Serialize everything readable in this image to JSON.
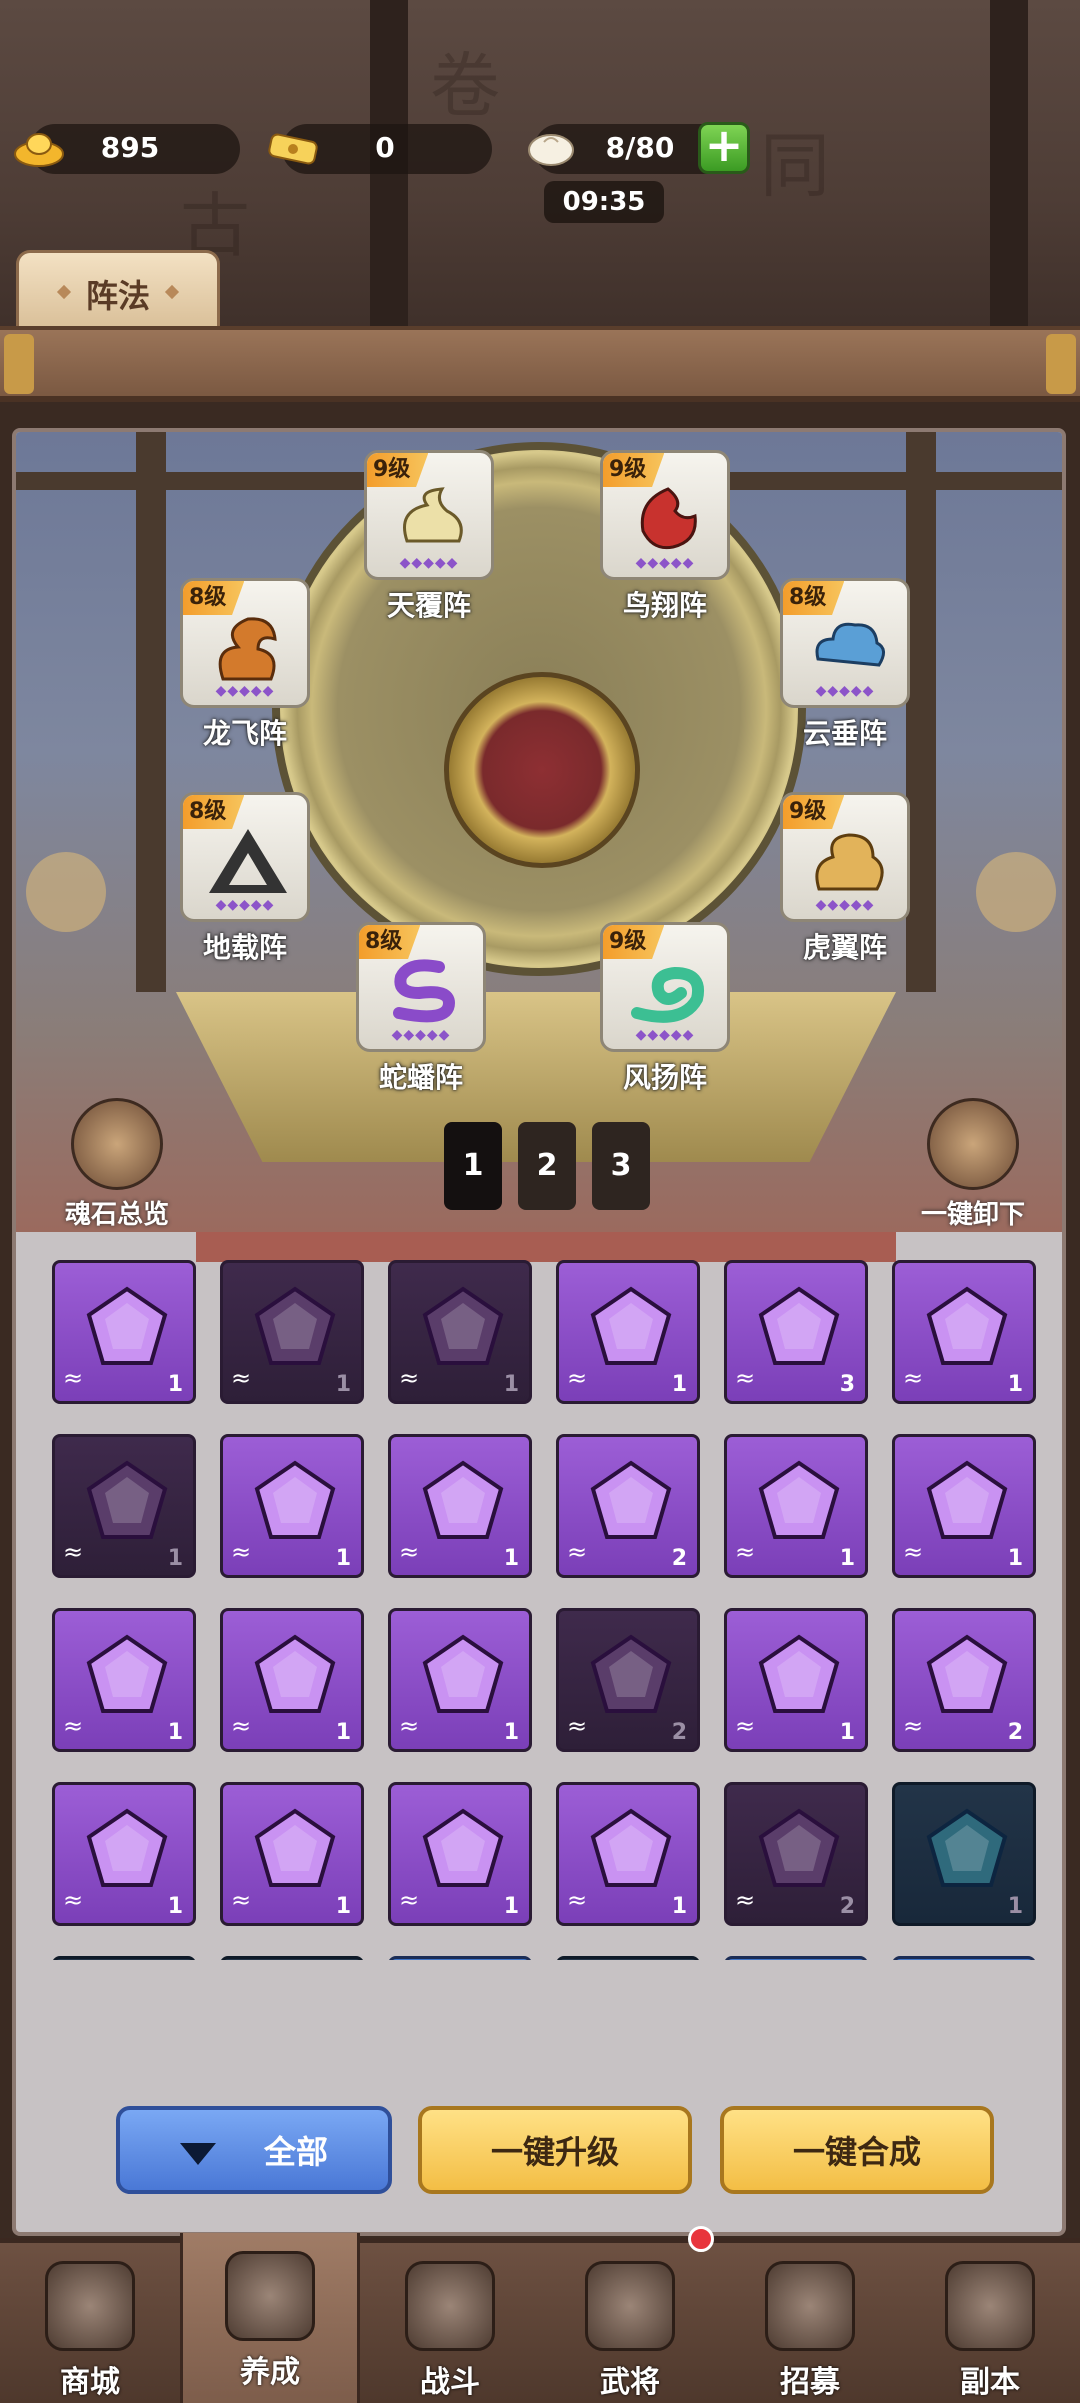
{
  "resources": {
    "gold": "895",
    "ingot": "0",
    "stamina": "8/80",
    "timer": "09:35"
  },
  "tab": {
    "label": "阵法"
  },
  "formations": [
    {
      "level": "9级",
      "name": "天覆阵",
      "color": "#e8d79a"
    },
    {
      "level": "9级",
      "name": "鸟翔阵",
      "color": "#c8322e"
    },
    {
      "level": "8级",
      "name": "龙飞阵",
      "color": "#d37a2c"
    },
    {
      "level": "8级",
      "name": "云垂阵",
      "color": "#5a9fd6"
    },
    {
      "level": "8级",
      "name": "地载阵",
      "color": "#333333"
    },
    {
      "level": "9级",
      "name": "虎翼阵",
      "color": "#e2b35a"
    },
    {
      "level": "8级",
      "name": "蛇蟠阵",
      "color": "#8a4bc9"
    },
    {
      "level": "9级",
      "name": "风扬阵",
      "color": "#3cbf93"
    }
  ],
  "side_buttons": {
    "soulstone_overview": "魂石总览",
    "unequip_all": "一键卸下"
  },
  "pages": [
    "1",
    "2",
    "3"
  ],
  "gems": [
    {
      "style": "purple",
      "count": "1"
    },
    {
      "style": "dim",
      "count": "1"
    },
    {
      "style": "dim",
      "count": "1"
    },
    {
      "style": "purple",
      "count": "1"
    },
    {
      "style": "purple",
      "count": "3"
    },
    {
      "style": "purple",
      "count": "1"
    },
    {
      "style": "dim",
      "count": "1"
    },
    {
      "style": "purple",
      "count": "1"
    },
    {
      "style": "purple",
      "count": "1"
    },
    {
      "style": "purple",
      "count": "2"
    },
    {
      "style": "purple",
      "count": "1"
    },
    {
      "style": "purple",
      "count": "1"
    },
    {
      "style": "purple",
      "count": "1"
    },
    {
      "style": "purple",
      "count": "1"
    },
    {
      "style": "purple",
      "count": "1"
    },
    {
      "style": "dim",
      "count": "2"
    },
    {
      "style": "purple",
      "count": "1"
    },
    {
      "style": "purple",
      "count": "2"
    },
    {
      "style": "purple",
      "count": "1"
    },
    {
      "style": "purple",
      "count": "1"
    },
    {
      "style": "purple",
      "count": "1"
    },
    {
      "style": "purple",
      "count": "1"
    },
    {
      "style": "dim",
      "count": "2"
    },
    {
      "style": "dblue",
      "count": "1"
    },
    {
      "style": "dblue",
      "count": ""
    },
    {
      "style": "dblue",
      "count": ""
    },
    {
      "style": "blue",
      "count": ""
    },
    {
      "style": "dblue",
      "count": ""
    },
    {
      "style": "blue",
      "count": ""
    },
    {
      "style": "blue",
      "count": ""
    }
  ],
  "actions": {
    "filter_all": "全部",
    "upgrade_all": "一键升级",
    "merge_all": "一键合成"
  },
  "nav": [
    {
      "label": "商城",
      "icon": "shop-icon"
    },
    {
      "label": "养成",
      "icon": "growth-icon"
    },
    {
      "label": "战斗",
      "icon": "battle-icon"
    },
    {
      "label": "武将",
      "icon": "general-icon"
    },
    {
      "label": "招募",
      "icon": "recruit-icon"
    },
    {
      "label": "副本",
      "icon": "dungeon-icon"
    }
  ],
  "colors": {
    "accent_yellow": "#f3be45",
    "accent_blue": "#4a78d6",
    "gem_purple": "#9c5ed6",
    "gem_blue": "#3e73c6"
  }
}
